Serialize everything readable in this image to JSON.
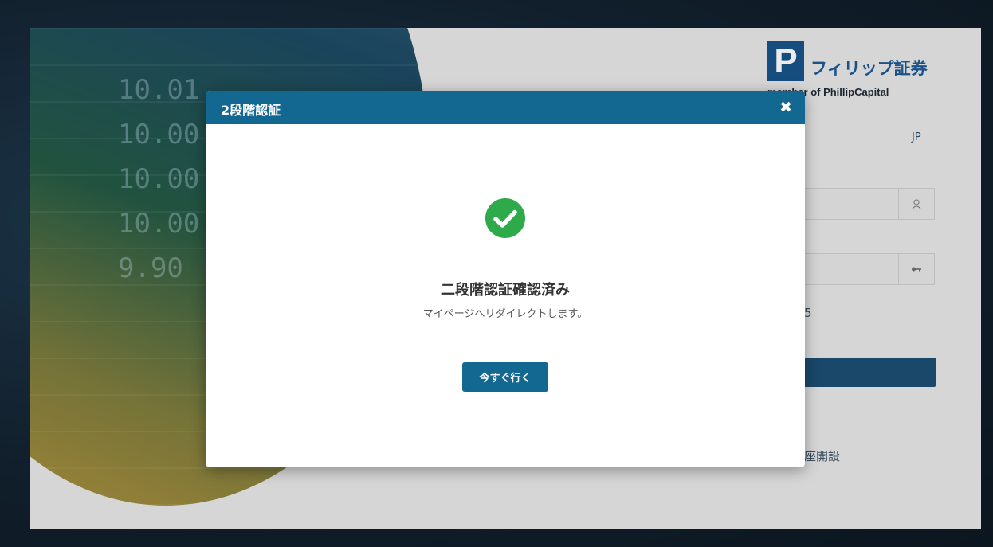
{
  "background": {
    "hero_digits": "10.01\n10.00\n10.00\n10.00\n9.90",
    "brand": {
      "logo_letter": "P",
      "name_jp": "フィリップ証券",
      "tagline": "member of PhillipCapital"
    },
    "language": "JP",
    "username_icon": "user-icon",
    "password_icon": "key-icon",
    "fragment_text_1": "5",
    "fragment_text_2": "座開設"
  },
  "modal": {
    "title": "2段階認証",
    "close_icon": "close-icon",
    "status_icon": "check-circle-icon",
    "status_color": "#2eaa4a",
    "header_color": "#136891",
    "status_title": "二段階認証確認済み",
    "status_message": "マイページへリダイレクトします。",
    "go_button_label": "今すぐ行く"
  }
}
